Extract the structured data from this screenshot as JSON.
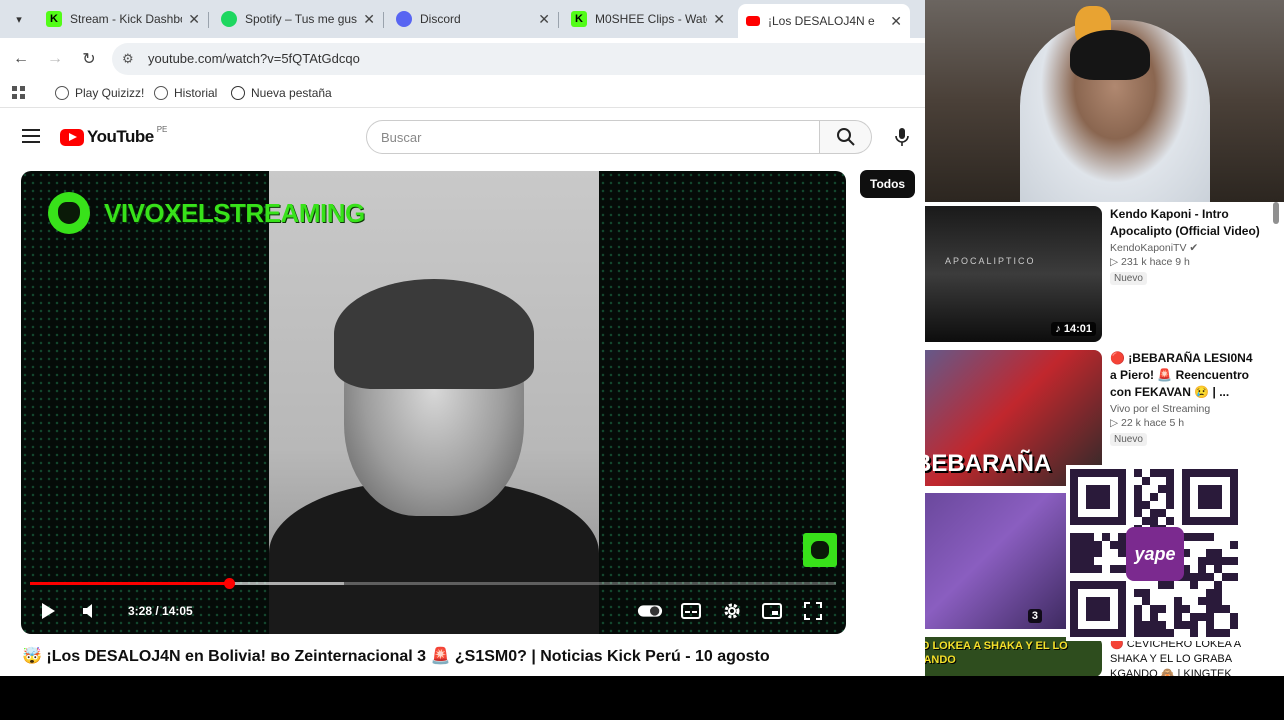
{
  "browser": {
    "tabs": [
      {
        "title": "Stream - Kick Dashbo",
        "favicon": "kick-icon",
        "color": "#53fc18"
      },
      {
        "title": "Spotify – Tus me gust",
        "favicon": "spotify-icon",
        "color": "#1ed760"
      },
      {
        "title": "Discord",
        "favicon": "discord-icon",
        "color": "#5865f2"
      },
      {
        "title": "M0SHEE Clips - Watc",
        "favicon": "kick-icon",
        "color": "#53fc18"
      },
      {
        "title": "¡Los DESALOJ4N e",
        "favicon": "youtube-icon",
        "color": "#ff0000",
        "active": true
      }
    ],
    "url": "youtube.com/watch?v=5fQTAtGdcqo",
    "bookmarks": [
      "Play Quizizz!",
      "Historial",
      "Nueva pestaña"
    ]
  },
  "youtube": {
    "logo_text": "YouTube",
    "country_code": "PE",
    "search_placeholder": "Buscar",
    "video": {
      "brand_text": "VIVOXELSTREAMING",
      "current_time": "3:28",
      "duration": "14:05",
      "time_display": "3:28 / 14:05",
      "progress": 0.247,
      "buffered": 0.39,
      "title": "🤯 ¡Los DESALOJ4N en Bolivia! ʙᴏ Zeinternacional 3 🚨 ¿S1SM0? | Noticias Kick Perú - 10 agosto"
    },
    "filter_chip": "Todos",
    "recommendations": [
      {
        "title": "Kendo Kaponi - Intro Apocalipto (Official Video)",
        "channel": "KendoKaponiTV ✔",
        "meta": "▷ 231 k   hace 9 h",
        "badge": "Nuevo",
        "duration": "♪ 14:01",
        "thumb_text": "APOCALIPTICO"
      },
      {
        "title": "🔴 ¡BEBARAÑA LESI0N4 a Piero! 🚨 Reencuentro con FEKAVAN 😢 | ...",
        "channel": "Vivo por el Streaming",
        "meta": "▷ 22 k   hace 5 h",
        "badge": "Nuevo",
        "thumb_text": "BEBARAÑA"
      },
      {
        "title": "",
        "channel": "",
        "meta": "",
        "duration": "3"
      },
      {
        "title": "🔴 CEVICHERO LOKEA A SHAKA Y EL LO GRABA KGANDO 🙈 | KINGTEK",
        "thumb_text": "CEVICHERO LOKEA A SHAKA Y EL LO GRABA KGANDO"
      }
    ],
    "qr_label": "yape"
  }
}
